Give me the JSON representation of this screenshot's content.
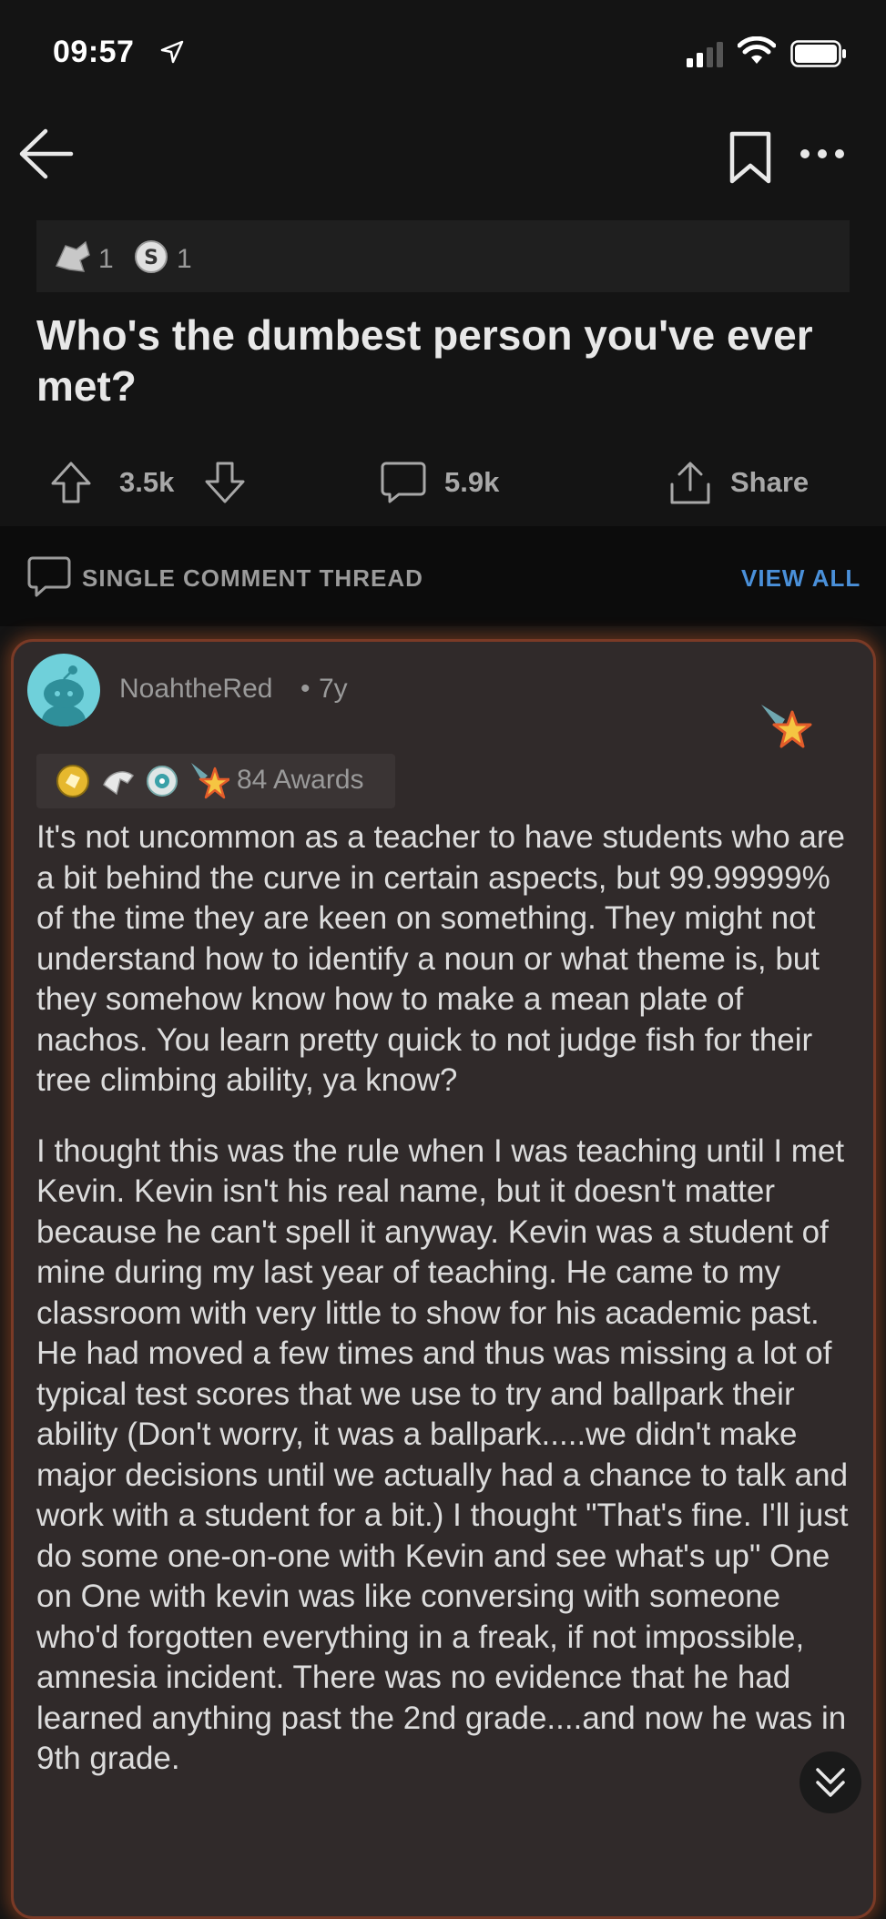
{
  "status": {
    "time": "09:57"
  },
  "post": {
    "awards": [
      {
        "icon": "silver-award-icon",
        "count": "1"
      },
      {
        "icon": "s-coin-award-icon",
        "count": "1"
      }
    ],
    "title": "Who's the dumbest person you've ever met?",
    "votes": "3.5k",
    "comments": "5.9k",
    "share_label": "Share"
  },
  "thread": {
    "label": "SINGLE COMMENT THREAD",
    "view_all": "VIEW ALL"
  },
  "comment": {
    "username": "NoahtheRed",
    "separator": "•",
    "age": "7y",
    "awards_label": "84 Awards",
    "paragraphs": [
      "It's not uncommon as a teacher to have students who are a bit behind the curve in certain aspects, but 99.99999% of the time they are keen on something. They might not understand how to identify a noun or what theme is, but they somehow know how to make a mean plate of nachos. You learn pretty quick to not judge fish for their tree climbing ability, ya know?",
      "I thought this was the rule when I was teaching until I met Kevin. Kevin isn't his real name, but it doesn't matter because he can't spell it anyway. Kevin was a student of mine during my last year of teaching. He came to my classroom with very little to show for his academic past. He had moved a few times and thus was missing a lot of typical test scores that we use to try and ballpark their ability (Don't worry, it was a ballpark.....we didn't make major decisions until we actually had a chance to talk and work with a student for a bit.) I thought \"That's fine. I'll just do some one-on-one with Kevin and see what's up\" One on One with kevin was like conversing with someone who'd forgotten everything in a freak, if not impossible, amnesia incident. There was no evidence that he had learned anything past the 2nd grade....and now he was in 9th grade."
    ]
  }
}
